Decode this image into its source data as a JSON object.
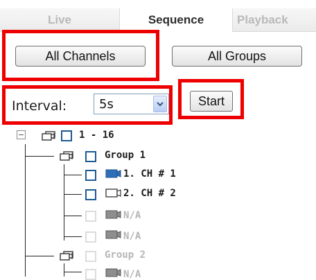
{
  "tabs": [
    {
      "label": "Live",
      "active": false
    },
    {
      "label": "Sequence",
      "active": true
    },
    {
      "label": "Playback",
      "active": false
    }
  ],
  "buttons": {
    "all_channels": "All Channels",
    "all_groups": "All Groups",
    "start": "Start"
  },
  "interval": {
    "label": "Interval:",
    "value": "5s"
  },
  "tree": {
    "root": {
      "label": "1 - 16",
      "expanded": true,
      "icon": "group-camera-icon"
    },
    "group1": {
      "label": "Group 1",
      "icon": "group-camera-icon"
    },
    "ch1": {
      "label": "1. CH # 1",
      "icon": "camera-active-icon"
    },
    "ch2": {
      "label": "2. CH # 2",
      "icon": "camera-icon"
    },
    "na1": {
      "label": "N/A",
      "icon": "camera-disabled-icon"
    },
    "na2": {
      "label": "N/A",
      "icon": "camera-disabled-icon"
    },
    "group2": {
      "label": "Group 2",
      "icon": "group-camera-icon"
    },
    "na3": {
      "label": "N/A",
      "icon": "camera-disabled-icon"
    }
  },
  "colors": {
    "highlight": "#ee0000",
    "checkbox_border": "#1c5a94",
    "camera_active": "#2f6fb8",
    "camera_disabled": "#8e8e8e"
  }
}
